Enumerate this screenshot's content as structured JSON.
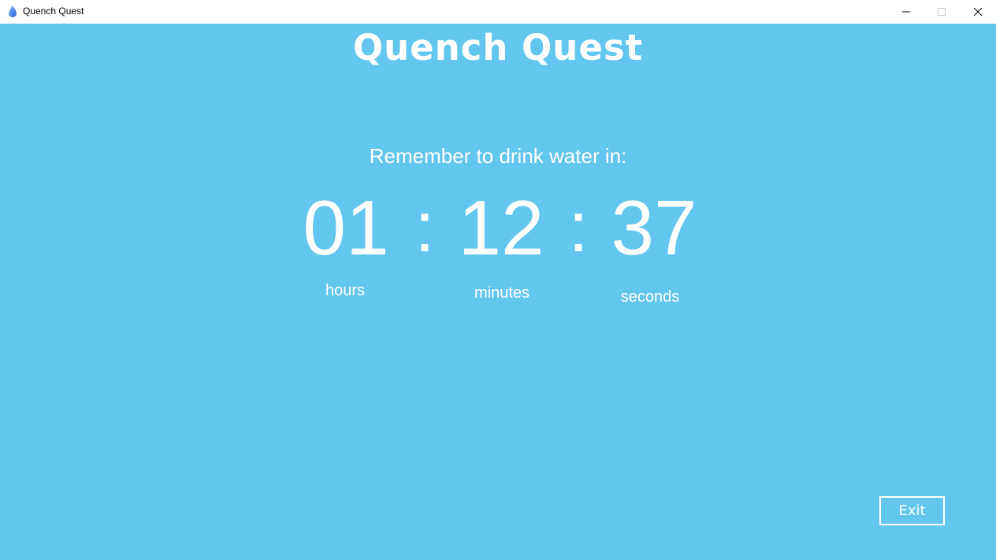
{
  "window": {
    "title": "Quench Quest",
    "icon": "water-drop-icon",
    "controls": [
      "minimize-icon",
      "maximize-icon",
      "close-icon"
    ]
  },
  "app": {
    "title": "Quench Quest",
    "background_color": "#63c6ef",
    "text_color": "#ffffff"
  },
  "timer": {
    "prompt": "Remember to drink water in:",
    "hours": "01",
    "minutes": "12",
    "seconds": "37",
    "separator": ":",
    "hours_label": "hours",
    "minutes_label": "minutes",
    "seconds_label": "seconds"
  },
  "actions": {
    "exit_label": "Exit"
  }
}
